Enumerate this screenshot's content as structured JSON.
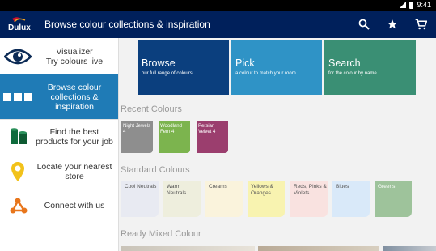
{
  "status": {
    "time": "9:41"
  },
  "appbar": {
    "logo": "Dulux",
    "title": "Browse colour collections & inspiration",
    "brand_color": "#00205b"
  },
  "sidebar": {
    "items": [
      {
        "line1": "Visualizer",
        "line2": "Try colours live",
        "icon": "eye-icon"
      },
      {
        "line1": "Browse colour",
        "line2": "collections &",
        "line3": "inspiration",
        "icon": "collections-icon",
        "active": true
      },
      {
        "line1": "Find the best",
        "line2": "products for your job",
        "icon": "paint-can-icon"
      },
      {
        "line1": "Locate your nearest",
        "line2": "store",
        "icon": "location-pin-icon"
      },
      {
        "line1": "Connect with us",
        "icon": "share-icon"
      }
    ],
    "active_color": "#1f7bb6"
  },
  "tiles": [
    {
      "title": "Browse",
      "subtitle": "our full range of colours",
      "color": "#0b3f7e"
    },
    {
      "title": "Pick",
      "subtitle": "a colour to match your room",
      "color": "#2f93c6"
    },
    {
      "title": "Search",
      "subtitle": "for the colour by name",
      "color": "#3a8f74"
    }
  ],
  "recent": {
    "heading": "Recent Colours",
    "swatches": [
      {
        "name": "Night Jewels 4",
        "color": "#8e8e8e"
      },
      {
        "name": "Woodland Fern 4",
        "color": "#7cb44e"
      },
      {
        "name": "Persian Velvet 4",
        "color": "#9b3e6e"
      }
    ]
  },
  "standard": {
    "heading": "Standard Colours",
    "cards": [
      {
        "name": "Cool Neutrals",
        "color": "#e8eaf2"
      },
      {
        "name": "Warm Neutrals",
        "color": "#eeeedd"
      },
      {
        "name": "Creams",
        "color": "#faf3dc"
      },
      {
        "name": "Yellows & Oranges",
        "color": "#f8f3b0"
      },
      {
        "name": "Reds, Pinks & Violets",
        "color": "#f9e2e0"
      },
      {
        "name": "Blues",
        "color": "#d9e9f9"
      },
      {
        "name": "Greens",
        "color": "#9ec39b"
      }
    ]
  },
  "ready_mixed": {
    "heading": "Ready Mixed Colour"
  }
}
